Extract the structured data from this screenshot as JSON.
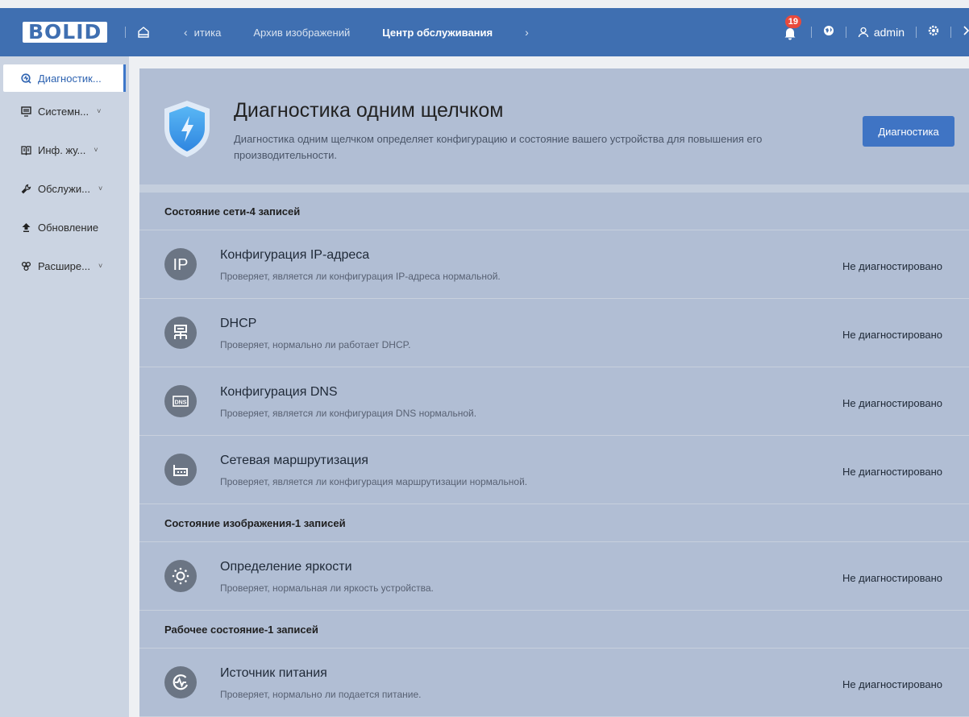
{
  "app": {
    "logo_text": "BOLID",
    "nav": {
      "back_label": "итика",
      "items": [
        "Архив изображений",
        "Центр обслуживания"
      ],
      "active_index": 1
    },
    "notifications_count": "19",
    "user": "admin",
    "colors": {
      "topbar": "#3f6fb1",
      "accent": "#3f74c4",
      "badge": "#e84a3c"
    }
  },
  "sidebar": {
    "items": [
      {
        "label": "Диагностик...",
        "icon": "diagnostic-icon",
        "active": true
      },
      {
        "label": "Системн...",
        "icon": "system-icon",
        "chevron": "˅"
      },
      {
        "label": "Инф. жу...",
        "icon": "log-book-icon",
        "chevron": "˅"
      },
      {
        "label": "Обслужи...",
        "icon": "maintenance-icon",
        "chevron": "˅"
      },
      {
        "label": "Обновление",
        "icon": "upgrade-icon"
      },
      {
        "label": "Расшире...",
        "icon": "extension-icon",
        "chevron": "˅"
      }
    ]
  },
  "hero": {
    "title": "Диагностика одним щелчком",
    "description": "Диагностика одним щелчком определяет конфигурацию и состояние вашего устройства для повышения его производительности.",
    "button": "Диагностика"
  },
  "sections": [
    {
      "title": "Состояние сети-4 записей",
      "rows": [
        {
          "icon": "ip-icon",
          "name": "Конфигурация IP-адреса",
          "desc": "Проверяет, является ли конфигурация IP-адреса нормальной.",
          "status": "Не диагностировано"
        },
        {
          "icon": "dhcp-icon",
          "name": "DHCP",
          "desc": "Проверяет, нормально ли работает DHCP.",
          "status": "Не диагностировано"
        },
        {
          "icon": "dns-icon",
          "name": "Конфигурация DNS",
          "desc": "Проверяет, является ли конфигурация DNS нормальной.",
          "status": "Не диагностировано"
        },
        {
          "icon": "router-icon",
          "name": "Сетевая маршрутизация",
          "desc": "Проверяет, является ли конфигурация маршрутизации нормальной.",
          "status": "Не диагностировано"
        }
      ]
    },
    {
      "title": "Состояние изображения-1 записей",
      "rows": [
        {
          "icon": "brightness-icon",
          "name": "Определение яркости",
          "desc": "Проверяет, нормальная ли яркость устройства.",
          "status": "Не диагностировано"
        }
      ]
    },
    {
      "title": "Рабочее состояние-1 записей",
      "rows": [
        {
          "icon": "power-icon",
          "name": "Источник питания",
          "desc": "Проверяет, нормально ли подается питание.",
          "status": "Не диагностировано"
        }
      ]
    }
  ]
}
